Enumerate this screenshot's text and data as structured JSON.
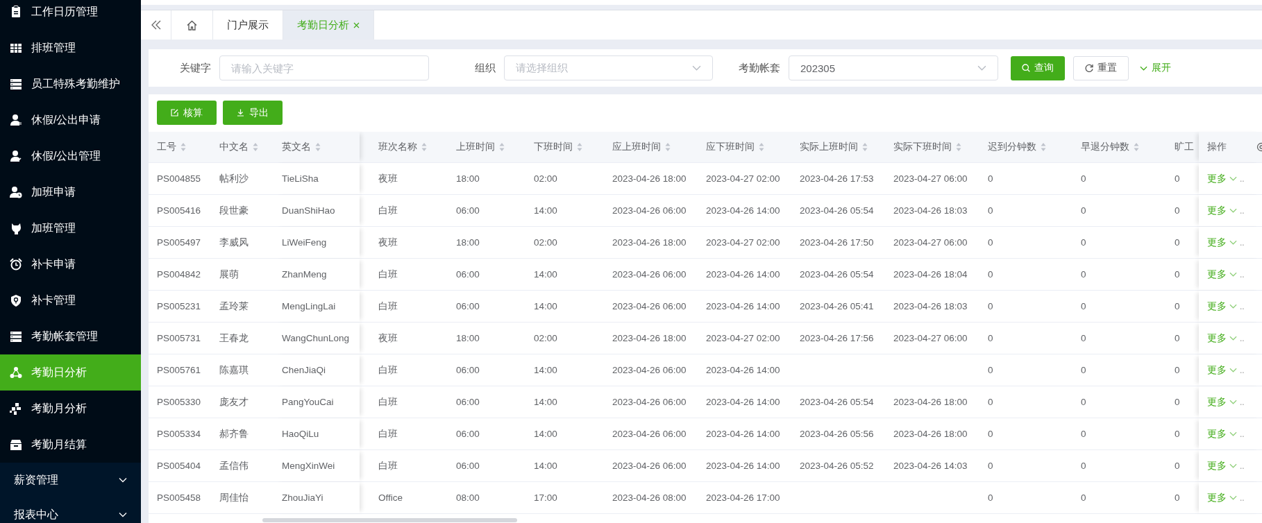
{
  "sidebar": {
    "items": [
      {
        "kind": "item",
        "label": "工作日历管理",
        "selected": false
      },
      {
        "kind": "item",
        "label": "排班管理",
        "selected": false
      },
      {
        "kind": "item",
        "label": "员工特殊考勤维护",
        "selected": false
      },
      {
        "kind": "item",
        "label": "休假/公出申请",
        "selected": false
      },
      {
        "kind": "item",
        "label": "休假/公出管理",
        "selected": false
      },
      {
        "kind": "item",
        "label": "加班申请",
        "selected": false
      },
      {
        "kind": "item",
        "label": "加班管理",
        "selected": false
      },
      {
        "kind": "item",
        "label": "补卡申请",
        "selected": false
      },
      {
        "kind": "item",
        "label": "补卡管理",
        "selected": false
      },
      {
        "kind": "item",
        "label": "考勤帐套管理",
        "selected": false
      },
      {
        "kind": "item",
        "label": "考勤日分析",
        "selected": true
      },
      {
        "kind": "item",
        "label": "考勤月分析",
        "selected": false
      },
      {
        "kind": "item",
        "label": "考勤月结算",
        "selected": false
      },
      {
        "kind": "group",
        "label": "薪资管理",
        "selected": false
      },
      {
        "kind": "group",
        "label": "报表中心",
        "selected": false
      }
    ]
  },
  "tabs": [
    {
      "label": "门户展示",
      "selected": false,
      "closable": false
    },
    {
      "label": "考勤日分析",
      "selected": true,
      "closable": true
    }
  ],
  "filters": [
    {
      "kind": "input",
      "label": "关键字",
      "placeholder": "请输入关键字"
    },
    {
      "kind": "select",
      "label": "组织",
      "placeholder": "请选择组织"
    },
    {
      "kind": "select",
      "label": "考勤帐套",
      "value": "202305"
    }
  ],
  "filter_buttons": [
    {
      "kind": "primary",
      "label": "查询"
    },
    {
      "kind": "default",
      "label": "重置"
    },
    {
      "kind": "link",
      "label": "展开"
    }
  ],
  "toolbar": [
    {
      "kind": "edit",
      "label": "核算"
    },
    {
      "kind": "download",
      "label": "导出"
    }
  ],
  "table": {
    "columns": [
      {
        "label": "工号",
        "sortable": true
      },
      {
        "label": "中文名",
        "sortable": true
      },
      {
        "label": "英文名",
        "sortable": true
      },
      {
        "label": "班次名称",
        "sortable": true
      },
      {
        "label": "上班时间",
        "sortable": true
      },
      {
        "label": "下班时间",
        "sortable": true
      },
      {
        "label": "应上班时间",
        "sortable": true
      },
      {
        "label": "应下班时间",
        "sortable": true
      },
      {
        "label": "实际上班时间",
        "sortable": true
      },
      {
        "label": "实际下班时间",
        "sortable": true
      },
      {
        "label": "迟到分钟数",
        "sortable": true
      },
      {
        "label": "早退分钟数",
        "sortable": true
      },
      {
        "label": "旷工"
      },
      {
        "label": "操作",
        "sortable": false
      }
    ],
    "rows": [
      {
        "cells": [
          "PS004855",
          "帖利沙",
          "TieLiSha",
          "夜班",
          "18:00",
          "02:00",
          "2023-04-26 18:00",
          "2023-04-27 02:00",
          "2023-04-26 17:53",
          "2023-04-27 06:00",
          "0",
          "0",
          "0"
        ],
        "action": "更多",
        "action_tail": ".."
      },
      {
        "cells": [
          "PS005416",
          "段世豪",
          "DuanShiHao",
          "白班",
          "06:00",
          "14:00",
          "2023-04-26 06:00",
          "2023-04-26 14:00",
          "2023-04-26 05:54",
          "2023-04-26 18:03",
          "0",
          "0",
          "0"
        ],
        "action": "更多",
        "action_tail": ".."
      },
      {
        "cells": [
          "PS005497",
          "李威风",
          "LiWeiFeng",
          "夜班",
          "18:00",
          "02:00",
          "2023-04-26 18:00",
          "2023-04-27 02:00",
          "2023-04-26 17:50",
          "2023-04-27 06:00",
          "0",
          "0",
          "0"
        ],
        "action": "更多",
        "action_tail": ".."
      },
      {
        "cells": [
          "PS004842",
          "展萌",
          "ZhanMeng",
          "白班",
          "06:00",
          "14:00",
          "2023-04-26 06:00",
          "2023-04-26 14:00",
          "2023-04-26 05:54",
          "2023-04-26 18:04",
          "0",
          "0",
          "0"
        ],
        "action": "更多",
        "action_tail": ".."
      },
      {
        "cells": [
          "PS005231",
          "孟玲莱",
          "MengLingLai",
          "白班",
          "06:00",
          "14:00",
          "2023-04-26 06:00",
          "2023-04-26 14:00",
          "2023-04-26 05:41",
          "2023-04-26 18:03",
          "0",
          "0",
          "0"
        ],
        "action": "更多",
        "action_tail": ".."
      },
      {
        "cells": [
          "PS005731",
          "王春龙",
          "WangChunLong",
          "夜班",
          "18:00",
          "02:00",
          "2023-04-26 18:00",
          "2023-04-27 02:00",
          "2023-04-26 17:56",
          "2023-04-27 06:00",
          "0",
          "0",
          "0"
        ],
        "action": "更多",
        "action_tail": ".."
      },
      {
        "cells": [
          "PS005761",
          "陈嘉琪",
          "ChenJiaQi",
          "白班",
          "06:00",
          "14:00",
          "2023-04-26 06:00",
          "2023-04-26 14:00",
          null,
          null,
          "0",
          "0",
          "0"
        ],
        "action": "更多",
        "action_tail": ".."
      },
      {
        "cells": [
          "PS005330",
          "庞友才",
          "PangYouCai",
          "白班",
          "06:00",
          "14:00",
          "2023-04-26 06:00",
          "2023-04-26 14:00",
          "2023-04-26 05:54",
          "2023-04-26 18:00",
          "0",
          "0",
          "0"
        ],
        "action": "更多",
        "action_tail": ".."
      },
      {
        "cells": [
          "PS005334",
          "郝齐鲁",
          "HaoQiLu",
          "白班",
          "06:00",
          "14:00",
          "2023-04-26 06:00",
          "2023-04-26 14:00",
          "2023-04-26 05:56",
          "2023-04-26 18:00",
          "0",
          "0",
          "0"
        ],
        "action": "更多",
        "action_tail": ".."
      },
      {
        "cells": [
          "PS005404",
          "孟信伟",
          "MengXinWei",
          "白班",
          "06:00",
          "14:00",
          "2023-04-26 06:00",
          "2023-04-26 14:00",
          "2023-04-26 05:52",
          "2023-04-26 14:03",
          "0",
          "0",
          "0"
        ],
        "action": "更多",
        "action_tail": ".."
      },
      {
        "cells": [
          "PS005458",
          "周佳怡",
          "ZhouJiaYi",
          "Office",
          "08:00",
          "17:00",
          "2023-04-26 08:00",
          "2023-04-26 17:00",
          null,
          null,
          "0",
          "0",
          "0"
        ],
        "action": "更多",
        "action_tail": ".."
      }
    ]
  }
}
